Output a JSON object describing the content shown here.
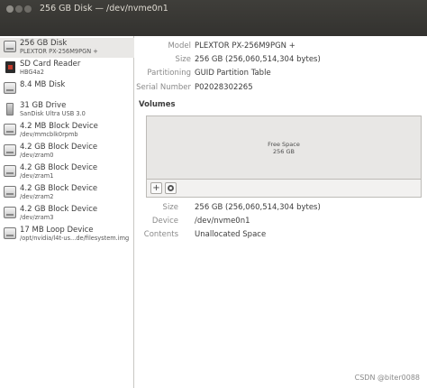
{
  "window": {
    "title": "256 GB Disk — /dev/nvme0n1"
  },
  "sidebar": {
    "items": [
      {
        "title": "256 GB Disk",
        "subtitle": "PLEXTOR PX-256M9PGN +",
        "icon": "disk-icon",
        "selected": true
      },
      {
        "title": "SD Card Reader",
        "subtitle": "HBG4a2",
        "icon": "sd-card-icon",
        "selected": false
      },
      {
        "title": "8.4 MB Disk",
        "subtitle": "",
        "icon": "disk-icon",
        "selected": false
      },
      {
        "title": "31 GB Drive",
        "subtitle": "SanDisk Ultra USB 3.0",
        "icon": "usb-drive-icon",
        "selected": false
      },
      {
        "title": "4.2 MB Block Device",
        "subtitle": "/dev/mmcblk0rpmb",
        "icon": "disk-icon",
        "selected": false
      },
      {
        "title": "4.2 GB Block Device",
        "subtitle": "/dev/zram0",
        "icon": "disk-icon",
        "selected": false
      },
      {
        "title": "4.2 GB Block Device",
        "subtitle": "/dev/zram1",
        "icon": "disk-icon",
        "selected": false
      },
      {
        "title": "4.2 GB Block Device",
        "subtitle": "/dev/zram2",
        "icon": "disk-icon",
        "selected": false
      },
      {
        "title": "4.2 GB Block Device",
        "subtitle": "/dev/zram3",
        "icon": "disk-icon",
        "selected": false
      },
      {
        "title": "17 MB Loop Device",
        "subtitle": "/opt/nvidia/l4t-us...de/filesystem.img",
        "icon": "disk-icon",
        "selected": false
      }
    ]
  },
  "disk": {
    "model_label": "Model",
    "model": "PLEXTOR PX-256M9PGN +",
    "size_label": "Size",
    "size": "256 GB (256,060,514,304 bytes)",
    "partitioning_label": "Partitioning",
    "partitioning": "GUID Partition Table",
    "serial_label": "Serial Number",
    "serial": "P02028302265"
  },
  "volumes": {
    "heading": "Volumes",
    "segment_name": "Free Space",
    "segment_size": "256 GB",
    "add_label": "+",
    "size_label": "Size",
    "size": "256 GB (256,060,514,304 bytes)",
    "device_label": "Device",
    "device": "/dev/nvme0n1",
    "contents_label": "Contents",
    "contents": "Unallocated Space"
  },
  "watermark": "CSDN @biter0088",
  "colors": {
    "titlebar": "#3a3935",
    "selected_row": "#e9e8e6",
    "volume_area": "#e6e5e3"
  }
}
